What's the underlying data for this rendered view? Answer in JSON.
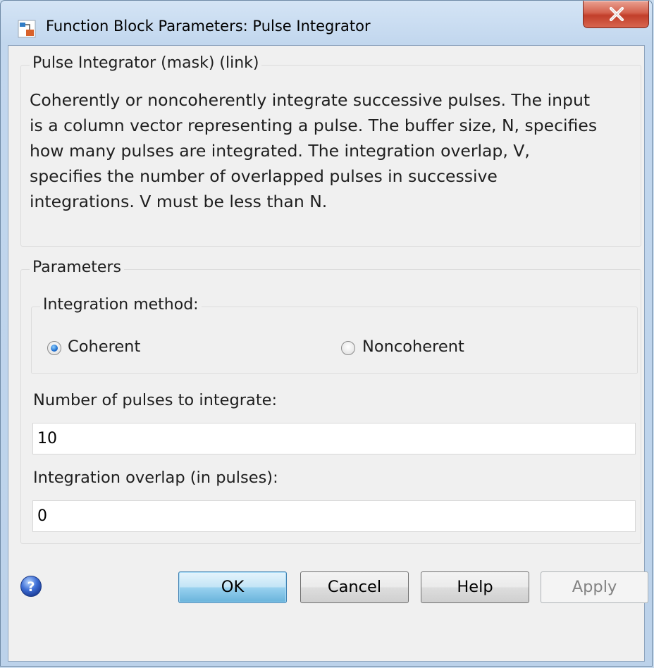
{
  "window": {
    "title": "Function Block Parameters: Pulse Integrator",
    "close_glyph": "X"
  },
  "description_group": {
    "legend": "Pulse Integrator (mask) (link)",
    "lines": [
      "Coherently or noncoherently integrate successive pulses. The input",
      "is a column vector representing a pulse. The buffer size, N, specifies",
      "how many pulses are integrated. The integration overlap, V,",
      "specifies the number of overlapped pulses in successive",
      "integrations. V must be less than N."
    ]
  },
  "parameters_group": {
    "legend": "Parameters",
    "integration_method": {
      "legend": "Integration method:",
      "options": [
        {
          "label": "Coherent",
          "selected": true
        },
        {
          "label": "Noncoherent",
          "selected": false
        }
      ]
    },
    "num_pulses": {
      "label": "Number of pulses to integrate:",
      "value": "10"
    },
    "overlap": {
      "label": "Integration overlap (in pulses):",
      "value": "0"
    }
  },
  "buttons": {
    "ok": "OK",
    "cancel": "Cancel",
    "help": "Help",
    "apply": "Apply"
  },
  "icons": {
    "app": "simulink-block-icon",
    "help": "help-question-icon",
    "close": "close-icon"
  },
  "colors": {
    "titlebar": "#c2d7ee",
    "close_button": "#c13e2a",
    "default_button": "#98d1ef",
    "radio_dot": "#1f6fcf",
    "client_background": "#f0f0f0"
  }
}
